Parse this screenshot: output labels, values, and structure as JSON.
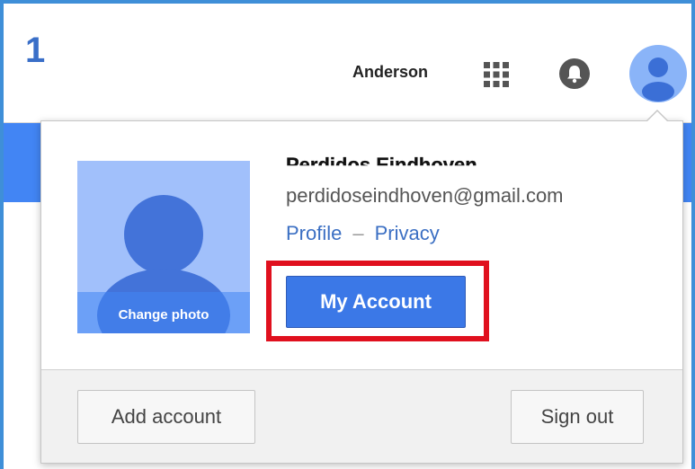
{
  "annotation": {
    "step_number": "1"
  },
  "header": {
    "user_name": "Anderson",
    "icons": {
      "apps": "apps-grid-icon",
      "notifications": "bell-icon",
      "avatar": "avatar-icon"
    }
  },
  "account_card": {
    "name": "Perdidos Eindhoven",
    "email": "perdidoseindhoven@gmail.com",
    "change_photo_label": "Change photo",
    "profile_link": "Profile",
    "separator": "–",
    "privacy_link": "Privacy",
    "my_account_button": "My Account",
    "add_account_button": "Add account",
    "sign_out_button": "Sign out"
  },
  "colors": {
    "frame_border": "#3f8fd8",
    "header_bar": "#4285f4",
    "primary_button": "#3b78e7",
    "highlight_box": "#e0101e",
    "link": "#3b6fc3"
  }
}
